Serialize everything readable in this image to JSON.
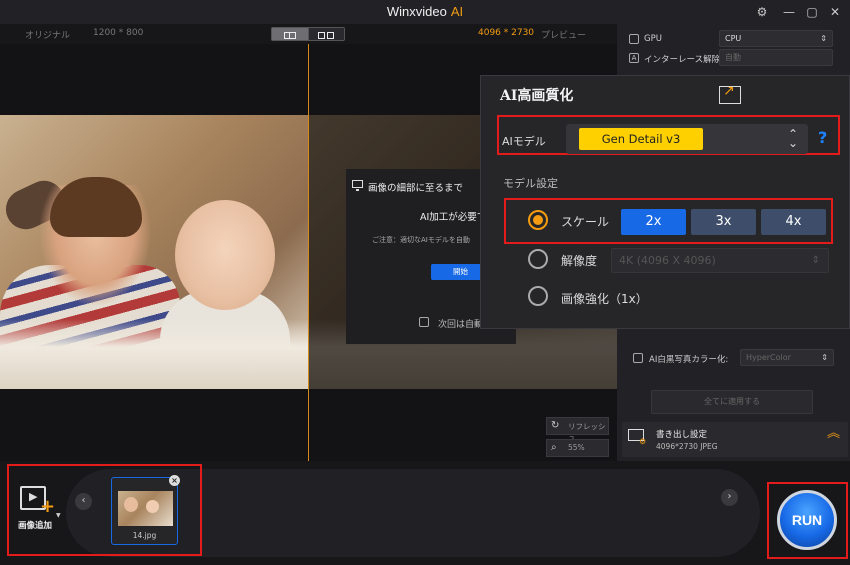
{
  "app": {
    "title": "Winxvideo",
    "title_ai": "AI",
    "settings_icon": "gear-icon",
    "minimize_icon": "minimize-icon",
    "maximize_icon": "maximize-icon",
    "close_icon": "close-icon"
  },
  "preview": {
    "original_label": "オリジナル",
    "original_size": "1200 * 800",
    "output_size": "4096 * 2730",
    "preview_label": "プレビュー",
    "refresh_label": "リフレッシュ",
    "zoom": "55%"
  },
  "dialog": {
    "title": "画像の細部に至るまで",
    "message": "AI加工が必要で",
    "note": "ご注意：適切なAIモデルを自動",
    "start_label": "開始",
    "dont_show_label": "次回は自動"
  },
  "right_panel": {
    "gpu_label": "GPU",
    "gpu_value": "CPU",
    "deinterlace_label": "インターレース解除",
    "deinterlace_value": "自動",
    "colorize_label": "AI白黒写真カラー化:",
    "colorize_value": "HyperColor",
    "apply_all_label": "全てに適用する",
    "export_label": "書き出し設定",
    "export_info": "4096*2730  JPEG"
  },
  "ai_panel": {
    "title": "AI高画質化",
    "model_label": "AIモデル",
    "model_value": "Gen Detail v3",
    "help": "?",
    "model_settings_label": "モデル設定",
    "scale_label": "スケール",
    "scale_options": [
      "2x",
      "3x",
      "4x"
    ],
    "resolution_label": "解像度",
    "resolution_value": "4K (4096 X 4096)",
    "enhance_label": "画像強化（1x）"
  },
  "bottom": {
    "add_image_label": "画像追加",
    "thumbnail_name": "14.jpg",
    "run_label": "RUN"
  },
  "colors": {
    "accent": "#f39c12",
    "primary_blue": "#1769e6",
    "model_chip": "#ffd000",
    "highlight_red": "#e31b1b"
  }
}
